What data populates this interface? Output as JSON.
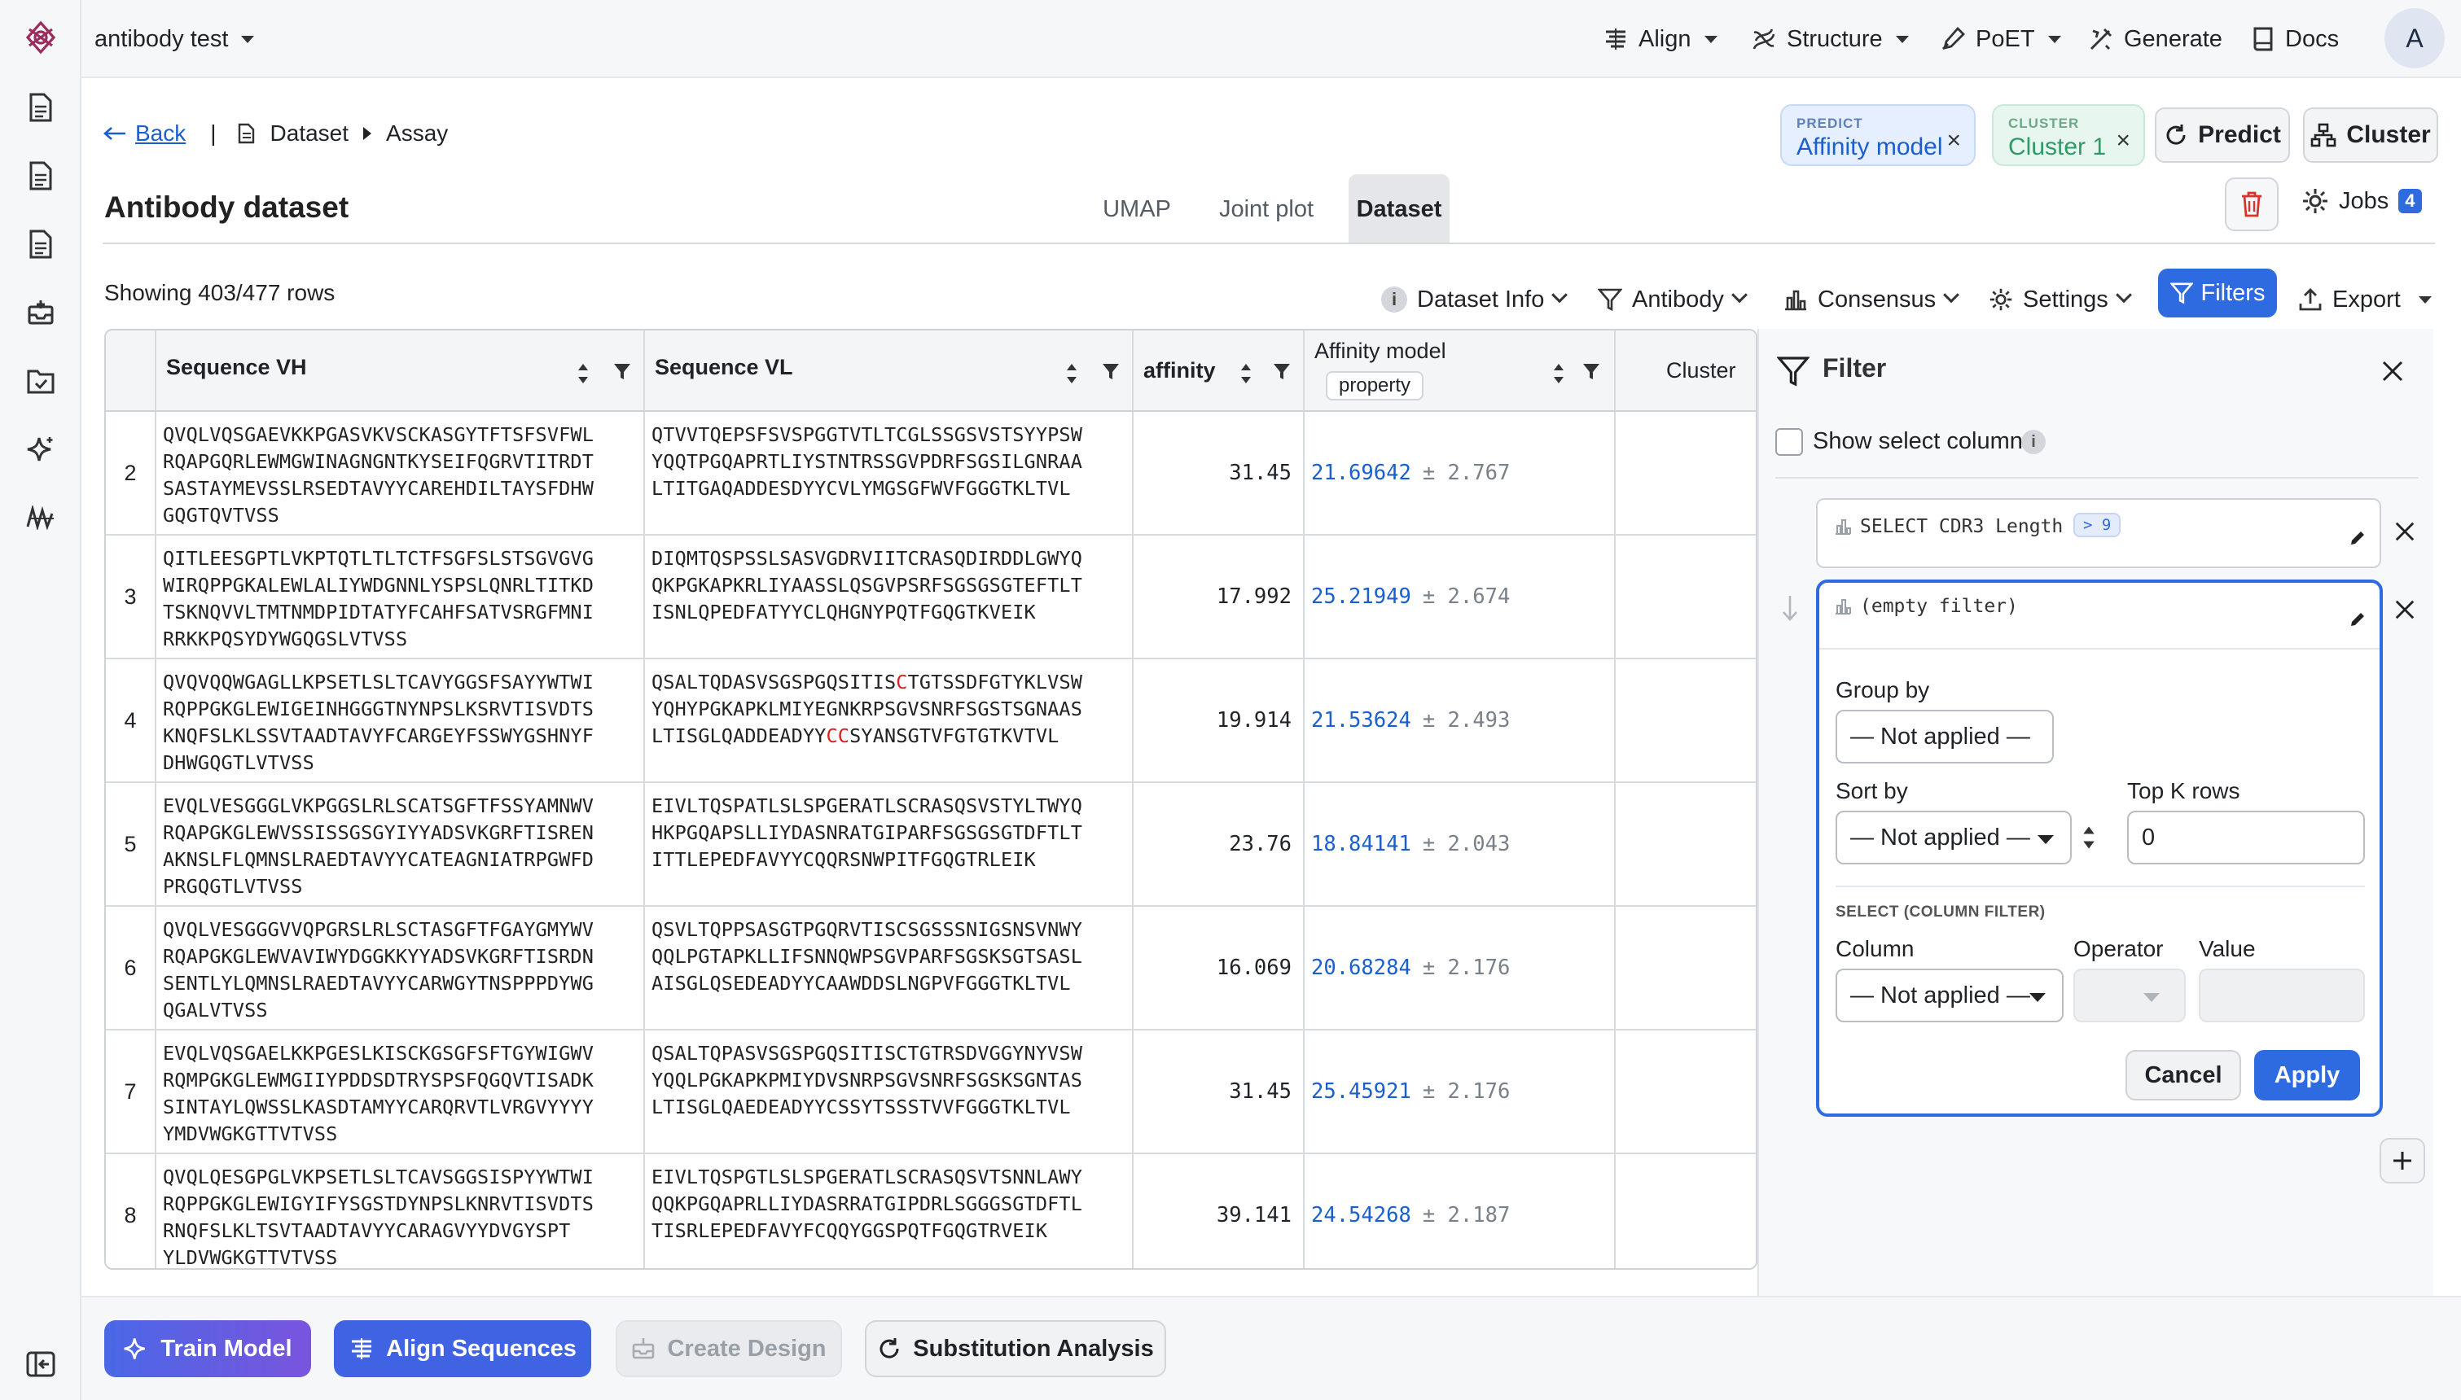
{
  "app": {
    "project_name": "antibody test"
  },
  "nav": {
    "align": "Align",
    "structure": "Structure",
    "poet": "PoET",
    "generate": "Generate",
    "docs": "Docs",
    "avatar": "A"
  },
  "breadcrumb": {
    "back": "Back",
    "separator": "|",
    "dataset": "Dataset",
    "assay": "Assay"
  },
  "chips": {
    "predict_label": "PREDICT",
    "predict_value": "Affinity model",
    "cluster_label": "CLUSTER",
    "cluster_value": "Cluster 1"
  },
  "actions": {
    "predict": "Predict",
    "cluster": "Cluster",
    "jobs": "Jobs",
    "jobs_count": "4"
  },
  "page": {
    "title": "Antibody dataset",
    "rows_info": "Showing 403/477 rows"
  },
  "tabs": [
    "UMAP",
    "Joint plot",
    "Dataset"
  ],
  "toolbar": {
    "dataset_info": "Dataset Info",
    "antibody": "Antibody",
    "consensus": "Consensus",
    "settings": "Settings",
    "filters": "Filters",
    "export": "Export"
  },
  "table": {
    "headers": {
      "vh": "Sequence VH",
      "vl": "Sequence VL",
      "affinity": "affinity",
      "model": "Affinity model",
      "model_badge": "property",
      "cluster": "Cluster"
    },
    "rows": [
      {
        "id": "2",
        "vh": [
          "QVQLVQSGAEVKKPGASVKVSCKASGYTFTSFSVFWL",
          "RQAPGQRLEWMGWINAGNGNTKYSEIFQGRVTITRDT",
          "SASTAYMEVSSLRSEDTAVYYCAREHDILTAYSFDHW",
          "GQGTQVTVSS"
        ],
        "vl": [
          "QTVVTQEPSFSVSPGGTVTLTCGLSSGSVSTSYYPSW",
          "YQQTPGQAPRTLIYSTNTRSSGVPDRFSGSILGNRAA",
          "LTITGAQADDESDYYCVLYMGSGFWVFGGGTKLTVL"
        ],
        "affinity": "31.45",
        "pred": "21.69642",
        "err": "± 2.767"
      },
      {
        "id": "3",
        "vh": [
          "QITLEESGPTLVKPTQTLTLTCTFSGFSLSTSGVGVG",
          "WIRQPPGKALEWLALIYWDGNNLYSPSLQNRLTITKD",
          "TSKNQVVLTMTNMDPIDTATYFCAHFSATVSRGFMNI",
          "RRKKPQSYDYWGQGSLVTVSS"
        ],
        "vl": [
          "DIQMTQSPSSLSASVGDRVIITCRASQDIRDDLGWYQ",
          "QKPGKAPKRLIYAASSLQSGVPSRFSGSGSGTEFTLT",
          "ISNLQPEDFATYYCLQHGNYPQTFGQGTKVEIK"
        ],
        "affinity": "17.992",
        "pred": "25.21949",
        "err": "± 2.674"
      },
      {
        "id": "4",
        "vh": [
          "QVQVQQWGAGLLKPSETLSLTCAVYGGSFSAYYWTWI",
          "RQPPGKGLEWIGEINHGGGTNYNPSLKSRVTISVDTS",
          "KNQFSLKLSSVTAADTAVYFCARGEYFSSWYGSHNYF",
          "DHWGQGTLVTVSS"
        ],
        "vl_pre": [
          "QSALTQDASVSGSPGQSITIS",
          "YQHYPGKAPKLMIYEGNKRPSGVSNRFSGSTSGNAAS",
          "LTISGLQADDEADYY"
        ],
        "vl_red": [
          "C",
          "CC"
        ],
        "vl_post": [
          "TGTSSDFGTYKLVSW",
          "SYANSGTVFGTGTKVTVL"
        ],
        "affinity": "19.914",
        "pred": "21.53624",
        "err": "± 2.493"
      },
      {
        "id": "5",
        "vh": [
          "EVQLVESGGGLVKPGGSLRLSCATSGFTFSSYAMNWV",
          "RQAPGKGLEWVSSISSGSGYIYYADSVKGRFTISREN",
          "AKNSLFLQMNSLRAEDTAVYYCATEAGNIATRPGWFD",
          "PRGQGTLVTVSS"
        ],
        "vl": [
          "EIVLTQSPATLSLSPGERATLSCRASQSVSTYLTWYQ",
          "HKPGQAPSLLIYDASNRATGIPARFSGSGSGTDFTLT",
          "ITTLEPEDFAVYYCQQRSNWPITFGQGTRLEIK"
        ],
        "affinity": "23.76",
        "pred": "18.84141",
        "err": "± 2.043"
      },
      {
        "id": "6",
        "vh": [
          "QVQLVESGGGVVQPGRSLRLSCTASGFTFGAYGMYWV",
          "RQAPGKGLEWVAVIWYDGGKKYYADSVKGRFTISRDN",
          "SENTLYLQMNSLRAEDTAVYYCARWGYTNSPPPDYWG",
          "QGALVTVSS"
        ],
        "vl": [
          "QSVLTQPPSASGTPGQRVTISCSGSSSNIGSNSVNWY",
          "QQLPGTAPKLLIFSNNQWPSGVPARFSGSKSGTSASL",
          "AISGLQSEDEADYYCAAWDDSLNGPVFGGGTKLTVL"
        ],
        "affinity": "16.069",
        "pred": "20.68284",
        "err": "± 2.176"
      },
      {
        "id": "7",
        "vh": [
          "EVQLVQSGAELKKPGESLKISCKGSGFSFTGYWIGWV",
          "RQMPGKGLEWMGIIYPDDSDTRYSPSFQGQVTISADK",
          "SINTAYLQWSSLKASDTAMYYCARQRVTLVRGVYYYY",
          "YMDVWGKGTTVTVSS"
        ],
        "vl": [
          "QSALTQPASVSGSPGQSITISCTGTRSDVGGYNYVSW",
          "YQQLPGKAPKPMIYDVSNRPSGVSNRFSGSKSGNTAS",
          "LTISGLQAEDEADYYCSSYTSSSTVVFGGGTKLTVL"
        ],
        "affinity": "31.45",
        "pred": "25.45921",
        "err": "± 2.176"
      },
      {
        "id": "8",
        "vh": [
          "QVQLQESGPGLVKPSETLSLTCAVSGGSISPYYWTWI",
          "RQPPGKGLEWIGYIFYSGSTDYNPSLKNRVTISVDTS",
          "RNQFSLKLTSVTAADTAVYYCARAGVYYDVGYSPT",
          "YLDVWGKGTTVTVSS"
        ],
        "vl": [
          "EIVLTQSPGTLSLSPGERATLSCRASQSVTSNNLAWY",
          "QQKPGQAPRLLIYDASRRATGIPDRLSGGGSGTDFTL",
          "TISRLEPEDFAVYFCQQYGGSPQTFGQGTRVEIK"
        ],
        "affinity": "39.141",
        "pred": "24.54268",
        "err": "± 2.187"
      }
    ]
  },
  "filter_panel": {
    "title": "Filter",
    "show_select_column": "Show select column",
    "filter1_select": "SELECT CDR3 Length",
    "filter1_badge": "> 9",
    "filter2_text": "(empty filter)",
    "group_by_label": "Group by",
    "group_by_value": "— Not applied —",
    "sort_by_label": "Sort by",
    "sort_by_value": "— Not applied —",
    "top_k_label": "Top K rows",
    "top_k_value": "0",
    "select_section": "SELECT (COLUMN FILTER)",
    "column_label": "Column",
    "column_value": "— Not applied —",
    "operator_label": "Operator",
    "value_label": "Value",
    "cancel": "Cancel",
    "apply": "Apply"
  },
  "bottom_actions": {
    "train_model": "Train Model",
    "align_sequences": "Align Sequences",
    "create_design": "Create Design",
    "substitution_analysis": "Substitution Analysis"
  },
  "colors": {
    "primary": "#2f6be0",
    "predict_chip_bg": "#e6efff",
    "cluster_chip_bg": "#e7f7ef",
    "cluster_text": "#2f9a68",
    "delete_red": "#d9342b",
    "link_blue": "#1a5fd0",
    "highlight_red": "#d9211f"
  },
  "icons": {
    "logo": "openprotein-logo",
    "sidebar": [
      "document-icon",
      "document-icon",
      "document-icon",
      "inbox-add-icon",
      "folder-check-icon",
      "sparkle-icon",
      "waveform-icon",
      "collapse-sidebar-icon"
    ]
  }
}
